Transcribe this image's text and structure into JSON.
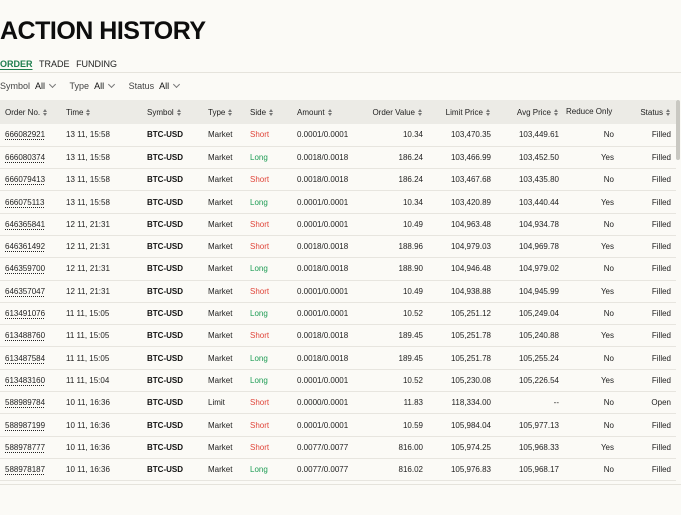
{
  "page": {
    "title": "ACTION HISTORY"
  },
  "tabs": [
    {
      "label": "ORDER",
      "active": true
    },
    {
      "label": "TRADE",
      "active": false
    },
    {
      "label": "FUNDING",
      "active": false
    }
  ],
  "filters": [
    {
      "label": "Symbol",
      "value": "All"
    },
    {
      "label": "Type",
      "value": "All"
    },
    {
      "label": "Status",
      "value": "All"
    }
  ],
  "columns": [
    "Order No.",
    "Time",
    "Symbol",
    "Type",
    "Side",
    "Amount",
    "Order Value",
    "Limit Price",
    "Avg Price",
    "Reduce Only",
    "Status"
  ],
  "rows": [
    [
      "666082921",
      "13 11, 15:58",
      "BTC-USD",
      "Market",
      "Short",
      "0.0001/0.0001",
      "10.34",
      "103,470.35",
      "103,449.61",
      "No",
      "Filled"
    ],
    [
      "666080374",
      "13 11, 15:58",
      "BTC-USD",
      "Market",
      "Long",
      "0.0018/0.0018",
      "186.24",
      "103,466.99",
      "103,452.50",
      "Yes",
      "Filled"
    ],
    [
      "666079413",
      "13 11, 15:58",
      "BTC-USD",
      "Market",
      "Short",
      "0.0018/0.0018",
      "186.24",
      "103,467.68",
      "103,435.80",
      "No",
      "Filled"
    ],
    [
      "666075113",
      "13 11, 15:58",
      "BTC-USD",
      "Market",
      "Long",
      "0.0001/0.0001",
      "10.34",
      "103,420.89",
      "103,440.44",
      "Yes",
      "Filled"
    ],
    [
      "646365841",
      "12 11, 21:31",
      "BTC-USD",
      "Market",
      "Short",
      "0.0001/0.0001",
      "10.49",
      "104,963.48",
      "104,934.78",
      "No",
      "Filled"
    ],
    [
      "646361492",
      "12 11, 21:31",
      "BTC-USD",
      "Market",
      "Short",
      "0.0018/0.0018",
      "188.96",
      "104,979.03",
      "104,969.78",
      "Yes",
      "Filled"
    ],
    [
      "646359700",
      "12 11, 21:31",
      "BTC-USD",
      "Market",
      "Long",
      "0.0018/0.0018",
      "188.90",
      "104,946.48",
      "104,979.02",
      "No",
      "Filled"
    ],
    [
      "646357047",
      "12 11, 21:31",
      "BTC-USD",
      "Market",
      "Short",
      "0.0001/0.0001",
      "10.49",
      "104,938.88",
      "104,945.99",
      "Yes",
      "Filled"
    ],
    [
      "613491076",
      "11 11, 15:05",
      "BTC-USD",
      "Market",
      "Long",
      "0.0001/0.0001",
      "10.52",
      "105,251.12",
      "105,249.04",
      "No",
      "Filled"
    ],
    [
      "613488760",
      "11 11, 15:05",
      "BTC-USD",
      "Market",
      "Short",
      "0.0018/0.0018",
      "189.45",
      "105,251.78",
      "105,240.88",
      "Yes",
      "Filled"
    ],
    [
      "613487584",
      "11 11, 15:05",
      "BTC-USD",
      "Market",
      "Long",
      "0.0018/0.0018",
      "189.45",
      "105,251.78",
      "105,255.24",
      "No",
      "Filled"
    ],
    [
      "613483160",
      "11 11, 15:04",
      "BTC-USD",
      "Market",
      "Long",
      "0.0001/0.0001",
      "10.52",
      "105,230.08",
      "105,226.54",
      "Yes",
      "Filled"
    ],
    [
      "588989784",
      "10 11, 16:36",
      "BTC-USD",
      "Limit",
      "Short",
      "0.0000/0.0001",
      "11.83",
      "118,334.00",
      "--",
      "No",
      "Open"
    ],
    [
      "588987199",
      "10 11, 16:36",
      "BTC-USD",
      "Market",
      "Short",
      "0.0001/0.0001",
      "10.59",
      "105,984.04",
      "105,977.13",
      "No",
      "Filled"
    ],
    [
      "588978777",
      "10 11, 16:36",
      "BTC-USD",
      "Market",
      "Short",
      "0.0077/0.0077",
      "816.00",
      "105,974.25",
      "105,968.33",
      "Yes",
      "Filled"
    ],
    [
      "588978187",
      "10 11, 16:36",
      "BTC-USD",
      "Market",
      "Long",
      "0.0077/0.0077",
      "816.02",
      "105,976.83",
      "105,968.17",
      "No",
      "Filled"
    ]
  ],
  "colors": {
    "long": "#1f9d55",
    "short": "#e0453a",
    "active_tab": "#1e7d4d",
    "header_bg": "#ecebe6"
  }
}
